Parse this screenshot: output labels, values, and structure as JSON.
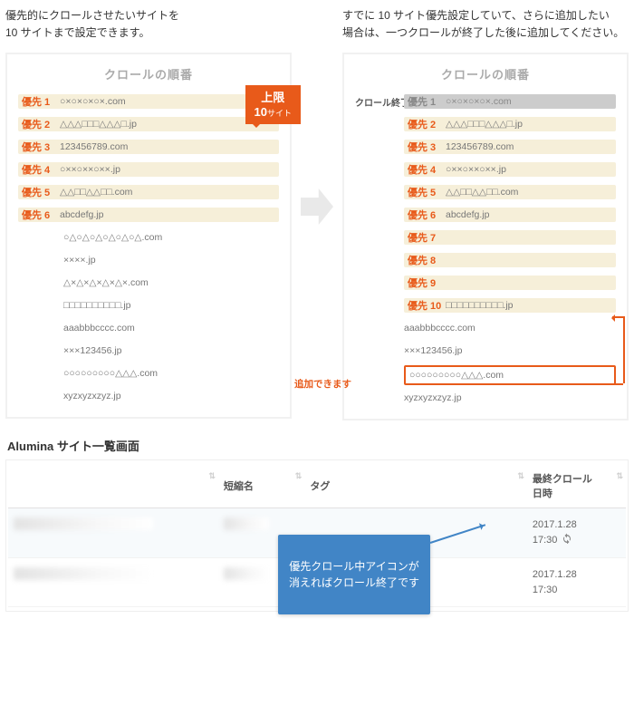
{
  "left": {
    "intro": "優先的にクロールさせたいサイトを\n10 サイトまで設定できます。",
    "panel_title": "クロールの順番",
    "callout_line1": "上限",
    "callout_line2_num": "10",
    "callout_line2_unit": "サイト",
    "priority": [
      {
        "label": "優先 1",
        "url": "○×○×○×○×.com"
      },
      {
        "label": "優先 2",
        "url": "△△△□□□△△△□.jp"
      },
      {
        "label": "優先 3",
        "url": "123456789.com"
      },
      {
        "label": "優先 4",
        "url": "○××○××○××.jp"
      },
      {
        "label": "優先 5",
        "url": "△△□□△△□□.com"
      },
      {
        "label": "優先 6",
        "url": "abcdefg.jp"
      }
    ],
    "queue": [
      "○△○△○△○△○△○△.com",
      "××××.jp",
      "△×△×△×△×△×.com",
      "□□□□□□□□□□.jp",
      "aaabbbcccc.com",
      "×××123456.jp",
      "○○○○○○○○○△△△.com",
      "xyzxyzxzyz.jp"
    ]
  },
  "right": {
    "intro": "すでに 10 サイト優先設定していて、さらに追加したい\n場合は、一つクロールが終了した後に追加してください。",
    "panel_title": "クロールの順番",
    "done_label": "クロール終了",
    "priority": [
      {
        "label": "優先 1",
        "url": "○×○×○×○×.com",
        "done": true
      },
      {
        "label": "優先 2",
        "url": "△△△□□□△△△□.jp"
      },
      {
        "label": "優先 3",
        "url": "123456789.com"
      },
      {
        "label": "優先 4",
        "url": "○××○××○××.jp"
      },
      {
        "label": "優先 5",
        "url": "△△□□△△□□.com"
      },
      {
        "label": "優先 6",
        "url": "abcdefg.jp"
      },
      {
        "label": "優先 7",
        "url": ""
      },
      {
        "label": "優先 8",
        "url": ""
      },
      {
        "label": "優先 9",
        "url": ""
      },
      {
        "label": "優先 10",
        "url": "□□□□□□□□□□.jp"
      }
    ],
    "queue": [
      "aaabbbcccc.com",
      "×××123456.jp"
    ],
    "addable_label": "追加できます",
    "addable_url": "○○○○○○○○○△△△.com",
    "after_queue": [
      "xyzxyzxzyz.jp"
    ]
  },
  "table": {
    "screen_title": "Alumina サイト一覧画面",
    "cols": {
      "name": "",
      "short": "短縮名",
      "tag": "タグ",
      "date": "最終クロール\n日時"
    },
    "rows": [
      {
        "date": "2017.1.28",
        "time": "17:30",
        "spinning": true
      },
      {
        "date": "2017.1.28",
        "time": "17:30",
        "spinning": false
      }
    ],
    "tip": "優先クロール中アイコンが\n消えればクロール終了です"
  }
}
